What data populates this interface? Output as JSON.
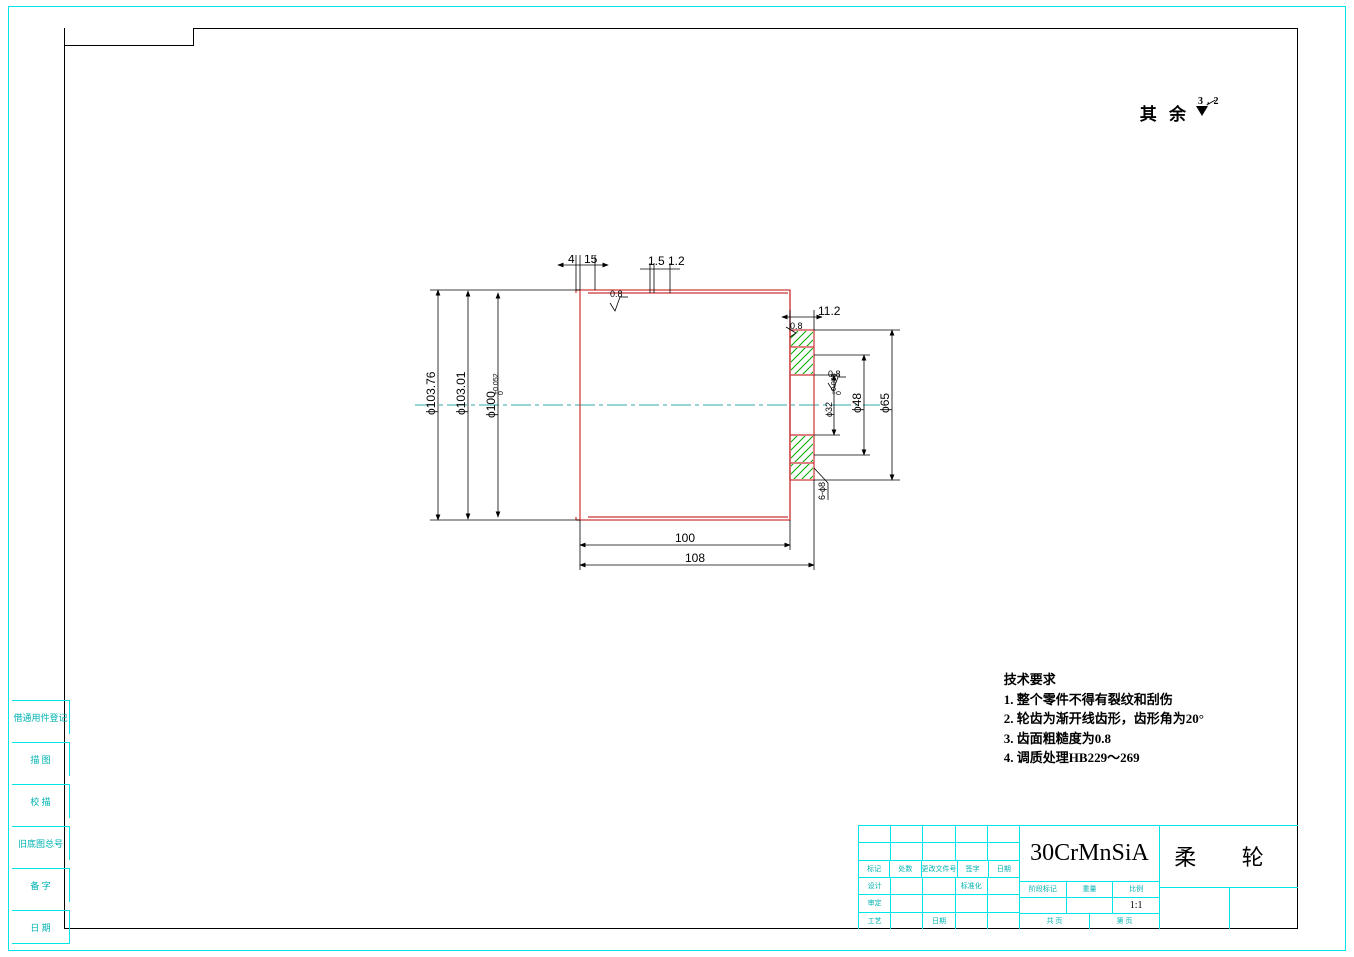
{
  "surface_note": {
    "label": "其 余",
    "value": "3.2"
  },
  "tech_req": {
    "title": "技术要求",
    "items": [
      "1. 整个零件不得有裂纹和刮伤",
      "2. 轮齿为渐开线齿形，齿形角为20°",
      "3. 齿面粗糙度为0.8",
      "4. 调质处理HB229～269"
    ]
  },
  "rev_labels": [
    "借通用件登记",
    "描  图",
    "校  描",
    "旧底图总号",
    "备  字",
    "日  期"
  ],
  "title_block": {
    "material": "30CrMnSiA",
    "part_name": "柔    轮",
    "ratio": "1:1",
    "left_labels": {
      "r1": [
        "标记",
        "处数",
        "更改文件号",
        "签字",
        "日期"
      ],
      "r2": [
        "设计",
        "",
        "",
        "标准化",
        ""
      ],
      "r3": [
        "审定",
        "",
        "",
        "",
        ""
      ],
      "r4": [
        "工艺",
        "",
        "日期",
        "",
        ""
      ]
    },
    "mid_labels": {
      "r1": [
        "阶段标记",
        "重量",
        "比例"
      ],
      "r3": [
        "共  页",
        "第  页"
      ]
    }
  },
  "dimensions": {
    "top_4": "4",
    "top_15": "15",
    "top_1_5": "1.5",
    "top_1_2": "1.2",
    "top_11_2": "11.2",
    "d103_76": "ϕ103.76",
    "d103_01": "ϕ103.01",
    "d100": "ϕ100",
    "d100_tol_top": "+0.052",
    "d100_tol_bot": "0",
    "d32": "ϕ32",
    "d32_tol_top": "+0.035",
    "d32_tol_bot": "0",
    "d48": "ϕ48",
    "d65": "ϕ65",
    "holes_6d8": "6-ϕ8",
    "len_100": "100",
    "len_108": "108",
    "surf_08": "0.8"
  }
}
